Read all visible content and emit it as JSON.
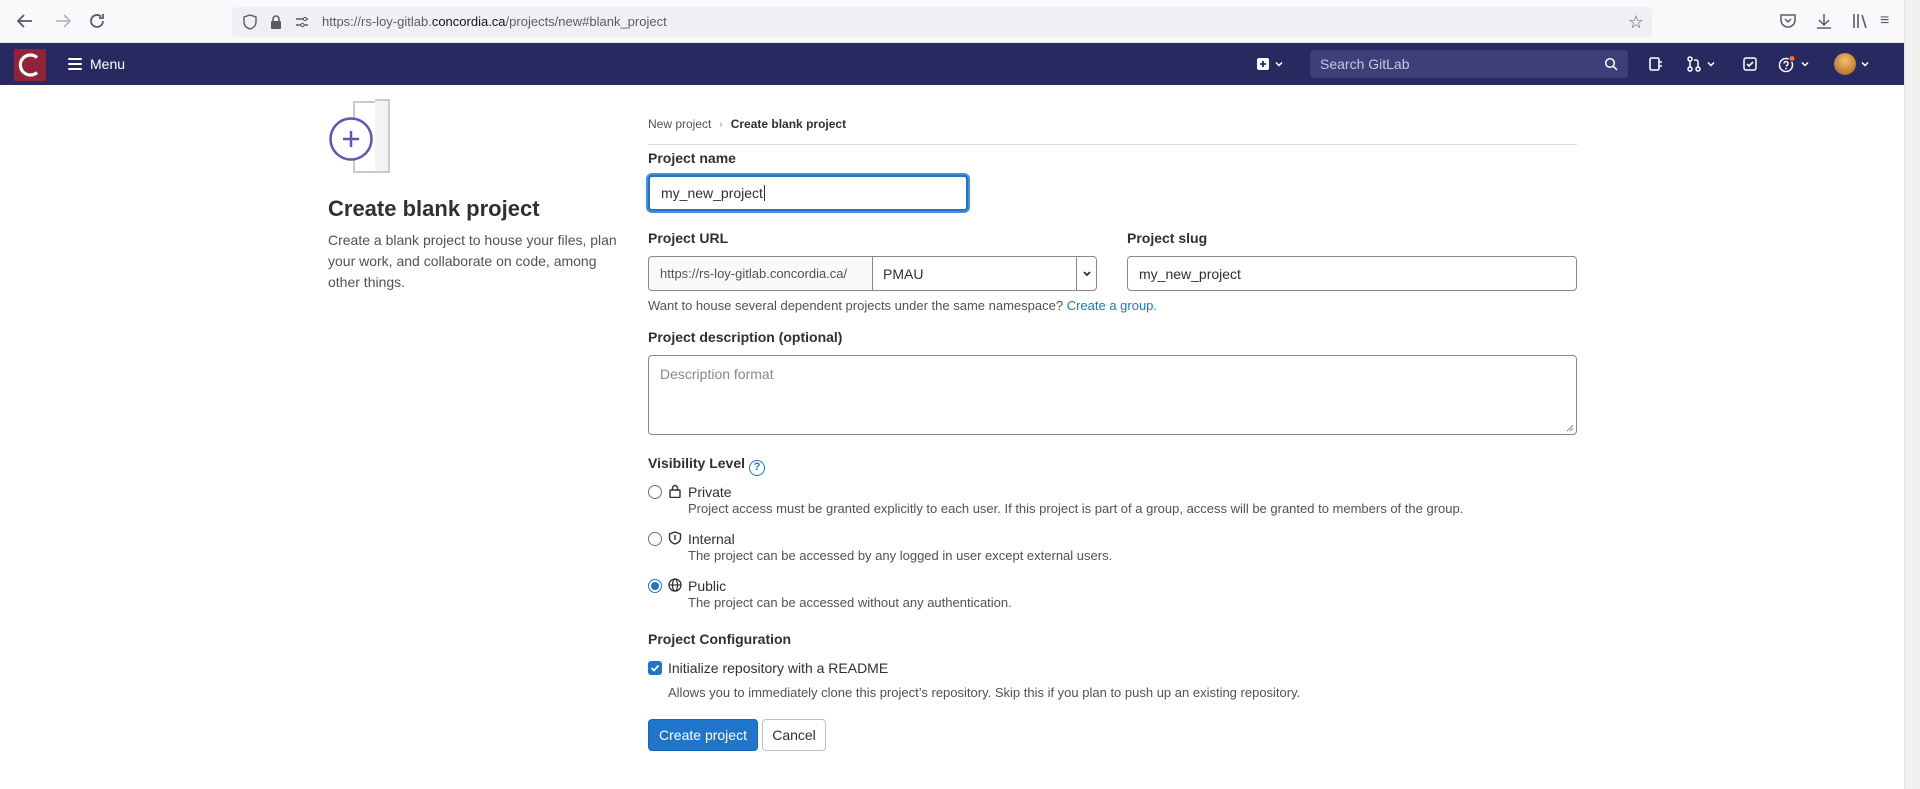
{
  "browser": {
    "url_prefix": "https://rs-loy-gitlab.",
    "url_domain": "concordia.ca",
    "url_path": "/projects/new#blank_project"
  },
  "nav": {
    "menu_label": "Menu",
    "search_placeholder": "Search GitLab",
    "brand_color": "#292961"
  },
  "left": {
    "title": "Create blank project",
    "description": "Create a blank project to house your files, plan your work, and collaborate on code, among other things."
  },
  "breadcrumb": {
    "parent": "New project",
    "current": "Create blank project"
  },
  "form": {
    "project_name_label": "Project name",
    "project_name_value": "my_new_project",
    "project_url_label": "Project URL",
    "url_prefix": "https://rs-loy-gitlab.concordia.ca/",
    "namespace": "PMAU",
    "project_slug_label": "Project slug",
    "project_slug_value": "my_new_project",
    "namespace_help": "Want to house several dependent projects under the same namespace?",
    "create_group_link": "Create a group.",
    "description_label": "Project description (optional)",
    "description_placeholder": "Description format",
    "visibility_label": "Visibility Level",
    "visibility_options": [
      {
        "title": "Private",
        "desc": "Project access must be granted explicitly to each user. If this project is part of a group, access will be granted to members of the group.",
        "checked": false,
        "icon": "lock-icon"
      },
      {
        "title": "Internal",
        "desc": "The project can be accessed by any logged in user except external users.",
        "checked": false,
        "icon": "shield-icon"
      },
      {
        "title": "Public",
        "desc": "The project can be accessed without any authentication.",
        "checked": true,
        "icon": "globe-icon"
      }
    ],
    "config_label": "Project Configuration",
    "readme_label": "Initialize repository with a README",
    "readme_help": "Allows you to immediately clone this project’s repository. Skip this if you plan to push up an existing repository.",
    "readme_checked": true,
    "create_button": "Create project",
    "cancel_button": "Cancel"
  }
}
